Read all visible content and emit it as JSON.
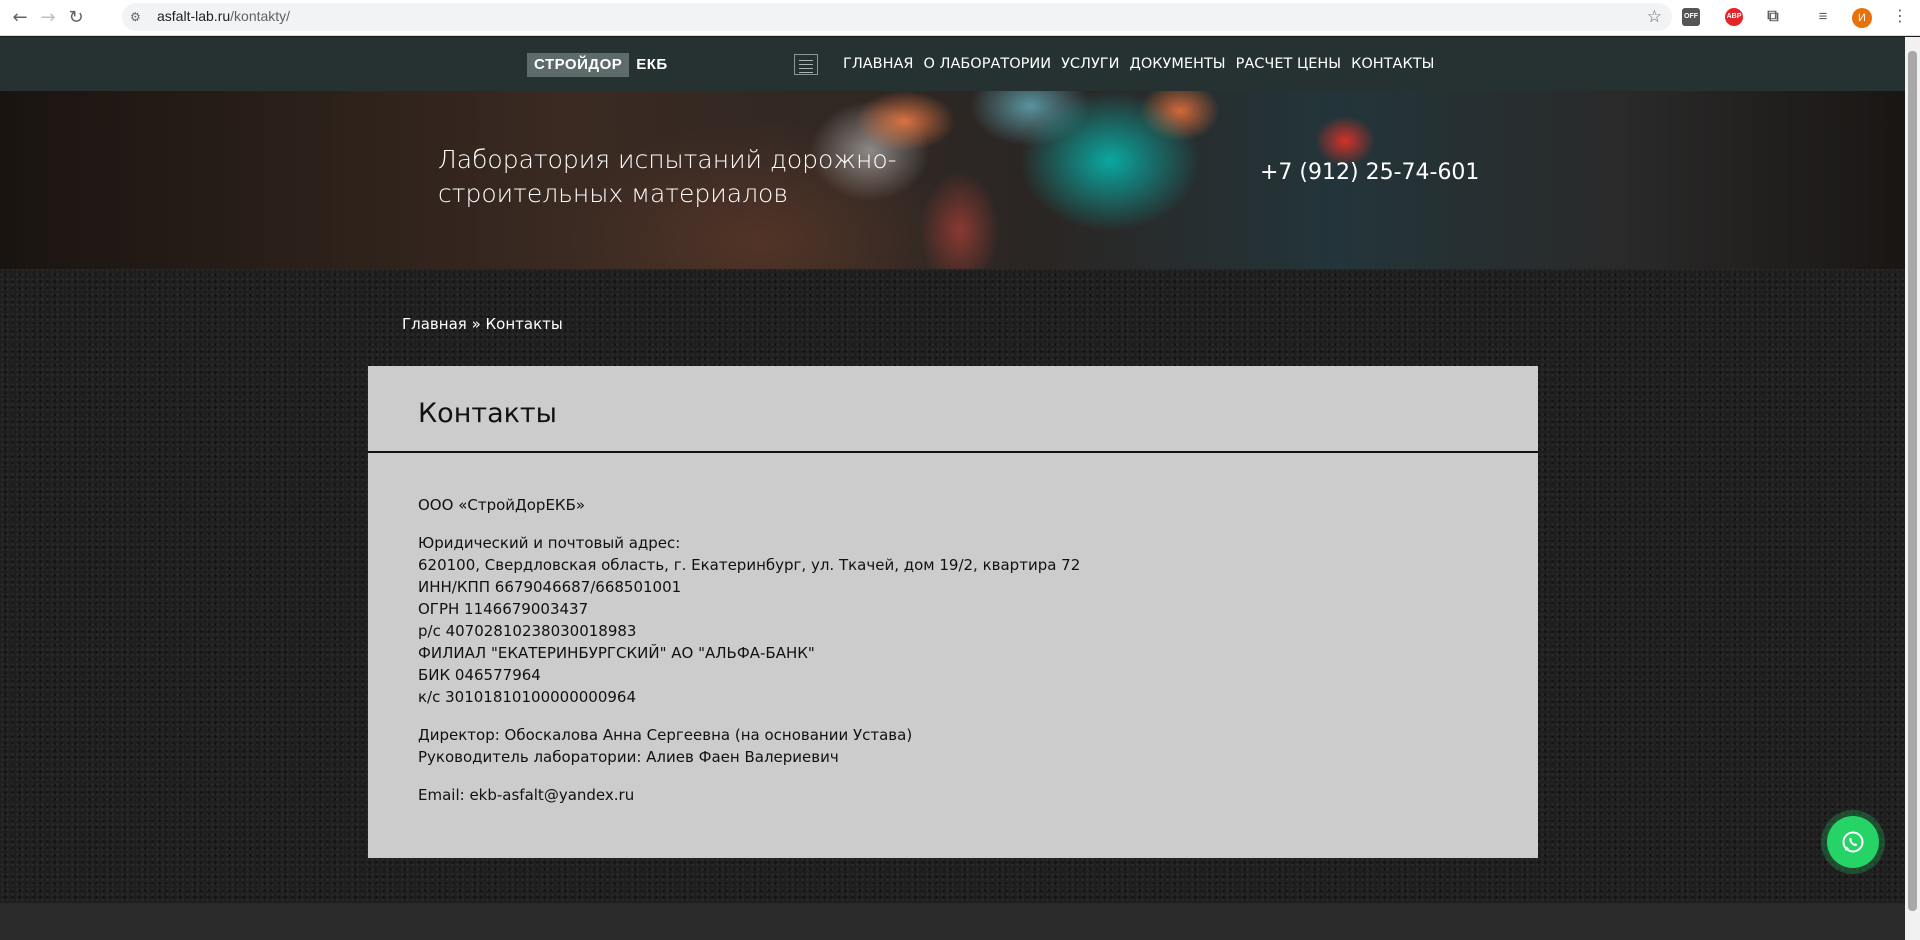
{
  "browser": {
    "url_host": "asfalt-lab.ru",
    "url_path": "/kontakty/",
    "ext_off_label": "OFF",
    "ext_abp_label": "ABP",
    "profile_initial": "И"
  },
  "nav": {
    "logo_part1": "СТРОЙДОР",
    "logo_part2": "ЕКБ",
    "items": [
      "ГЛАВНАЯ",
      "О ЛАБОРАТОРИИ",
      "УСЛУГИ",
      "ДОКУМЕНТЫ",
      "РАСЧЕТ ЦЕНЫ",
      "КОНТАКТЫ"
    ]
  },
  "hero": {
    "title_line1": "Лаборатория испытаний дорожно-",
    "title_line2": "строительных материалов",
    "phone": "+7 (912) 25-74-601"
  },
  "breadcrumb": {
    "home": "Главная",
    "separator": " » ",
    "current": "Контакты"
  },
  "contacts": {
    "title": "Контакты",
    "company": "ООО «СтройДорЕКБ»",
    "requisites": [
      "Юридический и почтовый адрес:",
      "620100, Свердловская область, г. Екатеринбург, ул. Ткачей, дом 19/2, квартира 72",
      "ИНН/КПП 6679046687/668501001",
      "ОГРН 1146679003437",
      "р/с 40702810238030018983",
      "ФИЛИАЛ \"ЕКАТЕРИНБУРГСКИЙ\" АО \"АЛЬФА-БАНК\"",
      "БИК 046577964",
      "к/с 30101810100000000964"
    ],
    "director": "Директор: Обоскалова Анна Сергеевна (на основании Устава)",
    "lab_head": "Руководитель лаборатории: Алиев Фаен Валериевич",
    "email": "Email: ekb-asfalt@yandex.ru"
  },
  "colors": {
    "nav_bg": "#263131",
    "card_bg": "#cccccc",
    "whatsapp": "#25d366"
  },
  "icons": [
    "back-icon",
    "forward-icon",
    "reload-icon",
    "site-info-icon",
    "star-icon",
    "extensions-icon",
    "media-icon",
    "menu-icon",
    "hamburger-icon",
    "whatsapp-icon"
  ]
}
